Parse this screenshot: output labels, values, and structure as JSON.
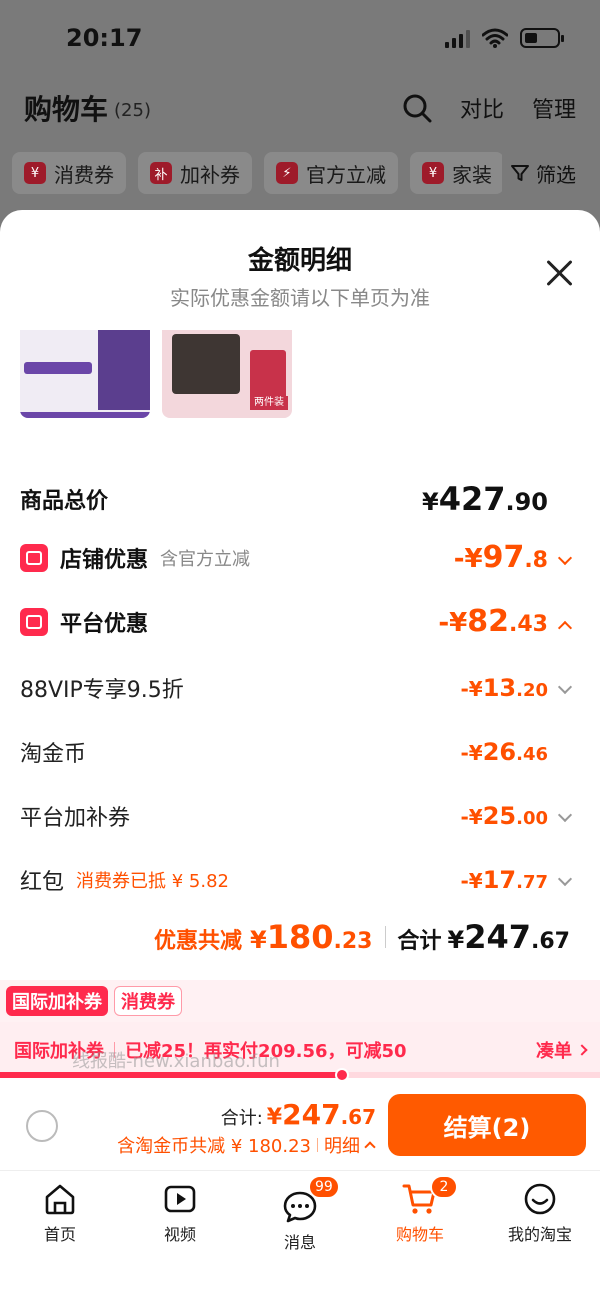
{
  "status": {
    "time": "20:17"
  },
  "header": {
    "title": "购物车",
    "count": "(25)",
    "compare": "对比",
    "manage": "管理"
  },
  "chips": [
    {
      "icon": "¥",
      "label": "消费券"
    },
    {
      "icon": "补",
      "label": "加补券"
    },
    {
      "icon": "⚡",
      "label": "官方立减"
    },
    {
      "icon": "¥",
      "label": "家装"
    }
  ],
  "filter_label": "筛选",
  "sheet": {
    "title": "金额明细",
    "subtitle": "实际优惠金额请以下单页为准",
    "thumb2_tag": "两件装",
    "total": {
      "label": "商品总价",
      "yen": "¥",
      "int": "427",
      "dec": ".90"
    },
    "shop_discount": {
      "label": "店铺优惠",
      "note": "含官方立减",
      "minus": "-¥",
      "int": "97",
      "dec": ".8"
    },
    "platform_discount": {
      "label": "平台优惠",
      "minus": "-¥",
      "int": "82",
      "dec": ".43"
    },
    "items": [
      {
        "label": "88VIP专享9.5折",
        "minus": "-¥",
        "int": "13",
        "dec": ".20",
        "note": ""
      },
      {
        "label": "淘金币",
        "minus": "-¥",
        "int": "26",
        "dec": ".46",
        "note": ""
      },
      {
        "label": "平台加补券",
        "minus": "-¥",
        "int": "25",
        "dec": ".00",
        "note": ""
      },
      {
        "label": "红包",
        "minus": "-¥",
        "int": "17",
        "dec": ".77",
        "note": "消费券已抵 ¥ 5.82"
      }
    ],
    "summary": {
      "discount_label": "优惠共减",
      "discount_yen": "¥",
      "discount_int": "180",
      "discount_dec": ".23",
      "total_label": "合计",
      "total_yen": "¥",
      "total_int": "247",
      "total_dec": ".67"
    }
  },
  "tags": [
    "国际加补券",
    "消费券"
  ],
  "promo": {
    "title": "国际加补券",
    "text": "已减25！再实付209.56，可减50",
    "action": "凑单",
    "progress": 0.57
  },
  "watermark": "线报酷-new.xianbao.fun",
  "checkout": {
    "label": "合计:",
    "yen": "¥",
    "int": "247",
    "dec": ".67",
    "sub": "含淘金币共减 ¥ 180.23",
    "detail": "明细",
    "pay": "结算(2)"
  },
  "tabbar": [
    {
      "label": "首页",
      "icon": "home-icon",
      "badge": ""
    },
    {
      "label": "视频",
      "icon": "video-icon",
      "badge": ""
    },
    {
      "label": "消息",
      "icon": "message-icon",
      "badge": "99"
    },
    {
      "label": "购物车",
      "icon": "cart-icon",
      "badge": "2"
    },
    {
      "label": "我的淘宝",
      "icon": "profile-icon",
      "badge": ""
    }
  ],
  "colors": {
    "accent": "#ff5000",
    "red": "#ff2a4d"
  }
}
